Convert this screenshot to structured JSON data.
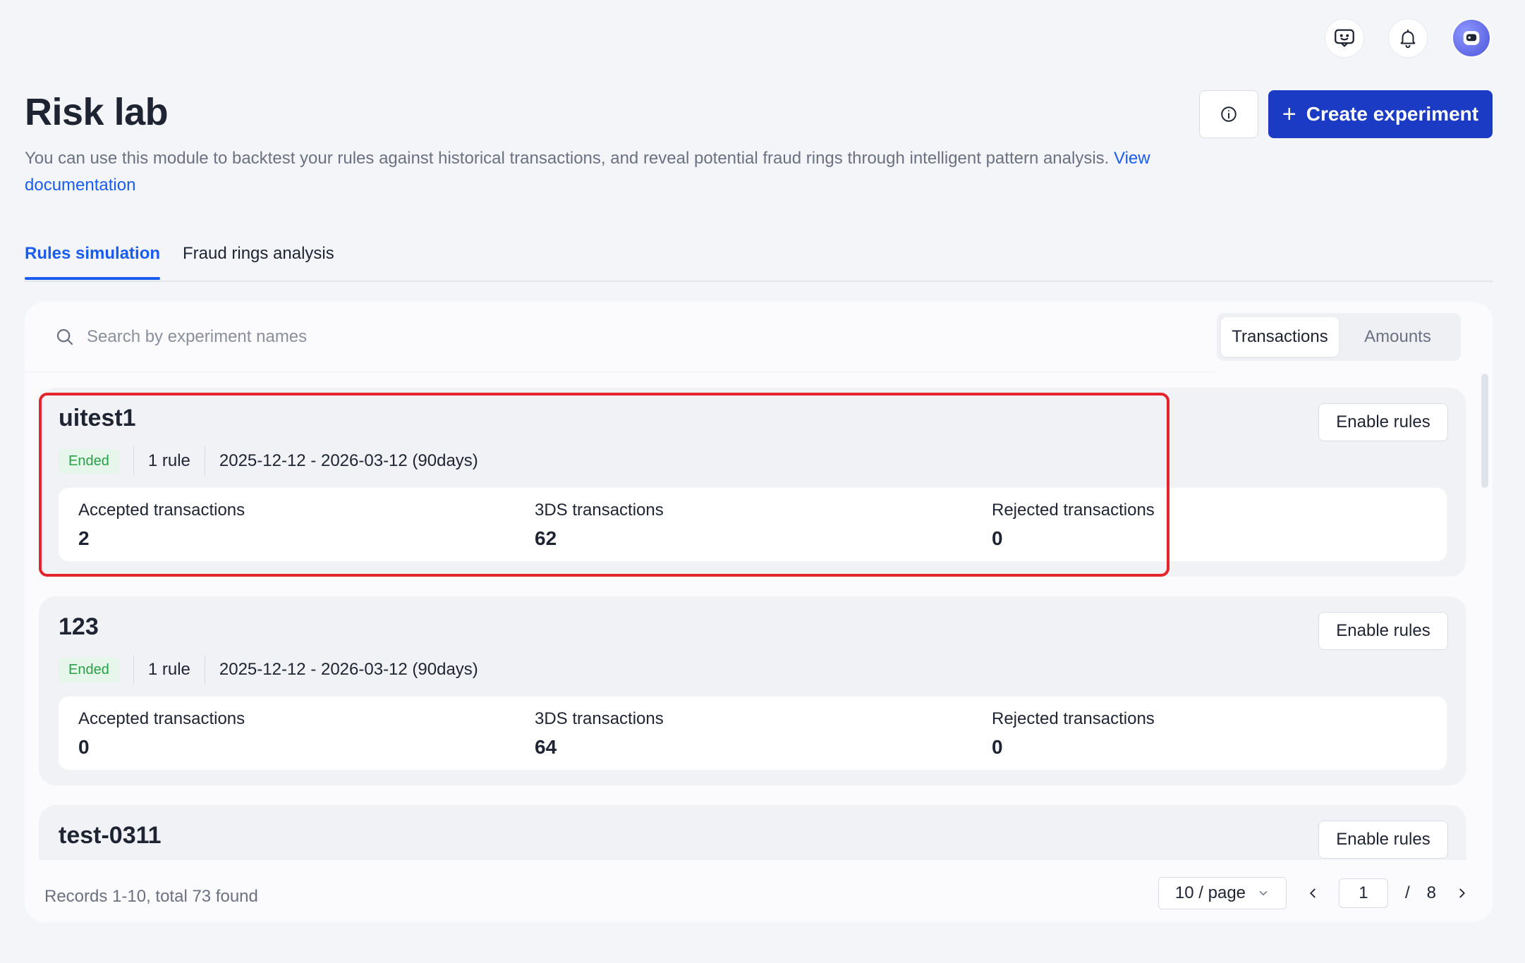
{
  "page": {
    "title": "Risk lab",
    "description": "You can use this module to backtest your rules against historical transactions, and reveal potential fraud rings through intelligent pattern analysis.",
    "doc_link": "View documentation",
    "create_label": "Create experiment"
  },
  "tabs": [
    {
      "label": "Rules simulation",
      "active": true
    },
    {
      "label": "Fraud rings analysis",
      "active": false
    }
  ],
  "search": {
    "placeholder": "Search by experiment names"
  },
  "toggle": {
    "options": [
      "Transactions",
      "Amounts"
    ],
    "selected": "Transactions"
  },
  "experiments": [
    {
      "name": "uitest1",
      "status": "Ended",
      "rules": "1 rule",
      "period": "2025-12-12 - 2026-03-12 (90days)",
      "enable_label": "Enable rules",
      "stats": [
        {
          "label": "Accepted transactions",
          "value": "2"
        },
        {
          "label": "3DS transactions",
          "value": "62"
        },
        {
          "label": "Rejected transactions",
          "value": "0"
        }
      ]
    },
    {
      "name": "123",
      "status": "Ended",
      "rules": "1 rule",
      "period": "2025-12-12 - 2026-03-12 (90days)",
      "enable_label": "Enable rules",
      "stats": [
        {
          "label": "Accepted transactions",
          "value": "0"
        },
        {
          "label": "3DS transactions",
          "value": "64"
        },
        {
          "label": "Rejected transactions",
          "value": "0"
        }
      ]
    },
    {
      "name": "test-0311",
      "enable_label": "Enable rules"
    }
  ],
  "pagination": {
    "records": "Records 1-10, total 73 found",
    "page_size": "10 / page",
    "current_page": "1",
    "separator": "/",
    "total_pages": "8"
  },
  "colors": {
    "primary": "#1b3bc4",
    "link": "#1a5cf0",
    "status_ended": "#27a046",
    "highlight": "#e4252c"
  }
}
